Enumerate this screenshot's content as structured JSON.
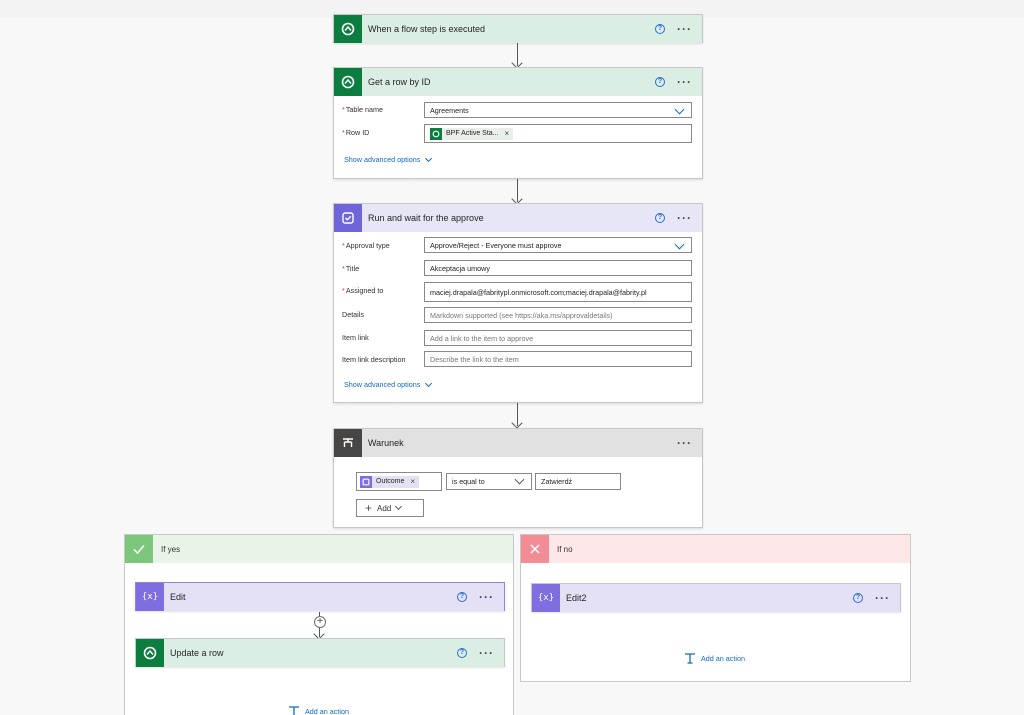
{
  "steps": {
    "trigger": {
      "title": "When a flow step is executed"
    },
    "get_row": {
      "title": "Get a row by ID",
      "table_label": "Table name",
      "table_value": "Agreements",
      "rowid_label": "Row ID",
      "rowid_token": "BPF Active Sta...",
      "advanced": "Show advanced options"
    },
    "approval": {
      "title": "Run and wait for the approve",
      "type_label": "Approval type",
      "type_value": "Approve/Reject - Everyone must approve",
      "title_label": "Title",
      "title_value": "Akceptacja umowy",
      "assigned_label": "Assigned to",
      "assigned_value": "maciej.drapala@fabritypl.onmicrosoft.com;maciej.drapala@fabrity.pl",
      "details_label": "Details",
      "details_placeholder": "Markdown supported (see https://aka.ms/approvaldetails)",
      "itemlink_label": "Item link",
      "itemlink_placeholder": "Add a link to the item to approve",
      "itemlinkdesc_label": "Item link description",
      "itemlinkdesc_placeholder": "Describe the link to the item",
      "advanced": "Show advanced options"
    },
    "condition": {
      "title": "Warunek",
      "token": "Outcome",
      "operator": "is equal to",
      "value": "Zatwierdź",
      "add_label": "Add"
    }
  },
  "branches": {
    "yes": {
      "title": "If yes",
      "edit_title": "Edit",
      "update_title": "Update a row",
      "add_action": "Add an action"
    },
    "no": {
      "title": "If no",
      "edit_title": "Edit2",
      "add_action": "Add an action"
    }
  },
  "colors": {
    "accent_blue": "#0f6cbd",
    "dataverse_green": "#0b7d3e",
    "approval_purple": "#6f64d8",
    "required_red": "#c4314b"
  }
}
